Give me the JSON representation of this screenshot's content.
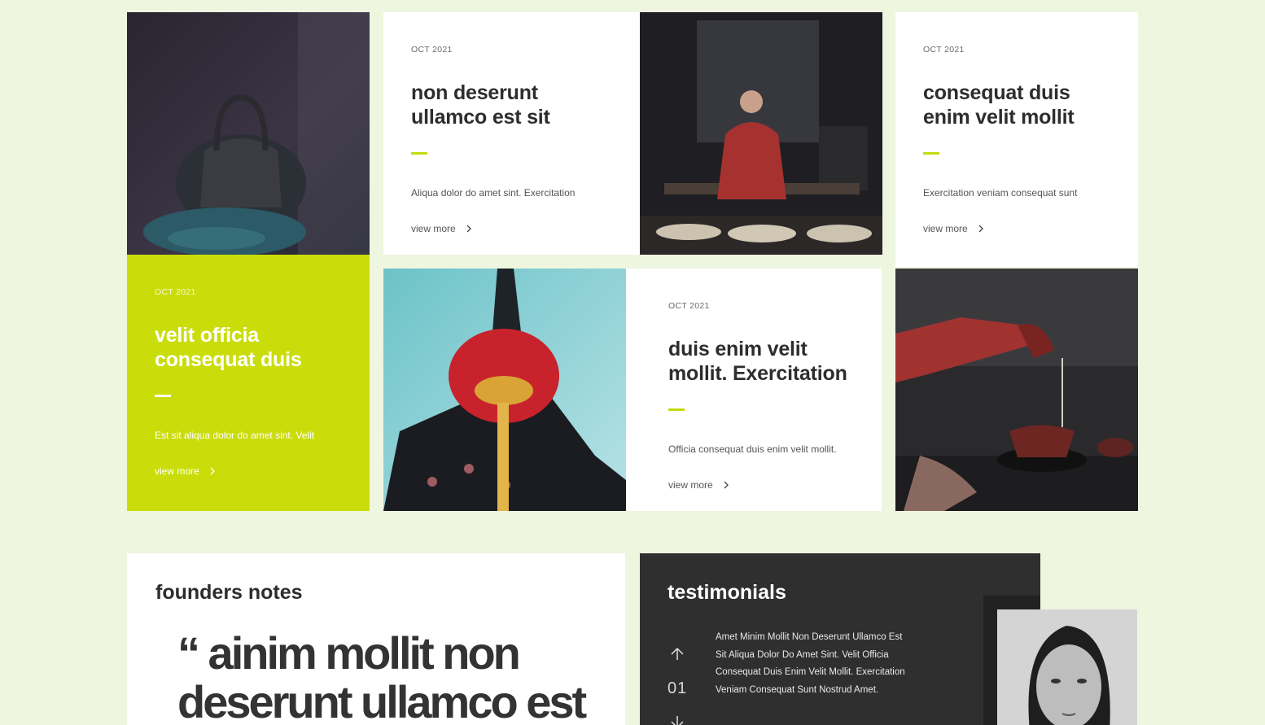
{
  "cards": {
    "c1": {
      "date": "OCT 2021",
      "title": "non deserunt ullamco est sit",
      "excerpt": "Aliqua dolor do amet sint. Exercitation",
      "more": "view more"
    },
    "c2": {
      "date": "OCT 2021",
      "title": "consequat duis enim velit mollit",
      "excerpt": "Exercitation veniam consequat sunt",
      "more": "view more"
    },
    "c3": {
      "date": "OCT 2021",
      "title": "velit officia consequat duis",
      "excerpt": "Est sit aliqua dolor do amet sint. Velit",
      "more": "view more"
    },
    "c4": {
      "date": "OCT 2021",
      "title": "duis enim velit mollit. Exercitation",
      "excerpt": "Officia consequat duis enim velit mollit.",
      "more": "view more"
    }
  },
  "founders": {
    "title": "founders notes",
    "quote": "“ ainim mollit non deserunt ullamco est"
  },
  "testimonials": {
    "title": "testimonials",
    "text": "Amet Minim Mollit Non Deserunt Ullamco Est Sit Aliqua Dolor Do Amet Sint. Velit Officia Consequat Duis Enim Velit Mollit. Exercitation Veniam Consequat Sunt Nostrud Amet.",
    "counter": "01"
  },
  "icons": {
    "arrow": "chevron-right-icon",
    "up": "arrow-up-icon",
    "down": "arrow-down-icon"
  },
  "colors": {
    "page_bg": "#eff6e0",
    "accent": "#cadd0b",
    "dark": "#2f2f2f"
  }
}
